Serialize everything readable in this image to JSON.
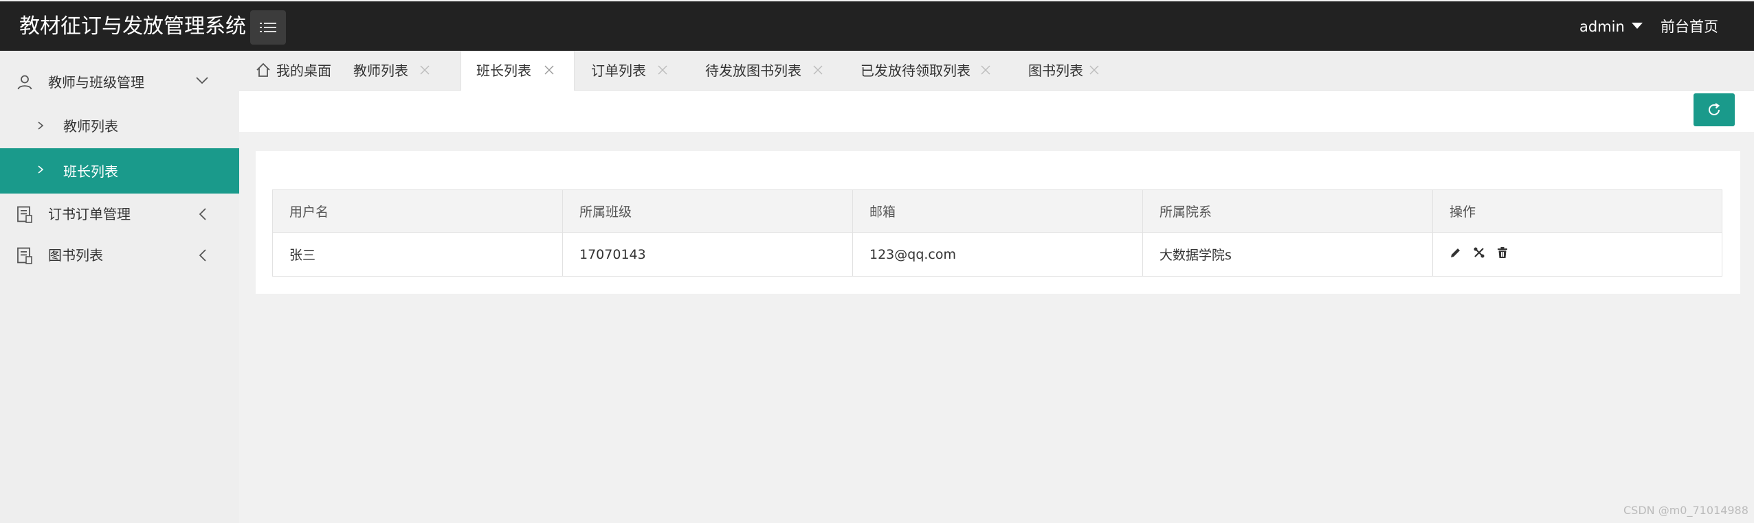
{
  "header": {
    "title": "教材征订与发放管理系统",
    "user": "admin",
    "front_link": "前台首页"
  },
  "sidebar": {
    "groups": [
      {
        "label": "教师与班级管理",
        "icon": "user-icon",
        "expanded": true,
        "children": [
          {
            "label": "教师列表"
          },
          {
            "label": "班长列表",
            "active": true
          }
        ]
      },
      {
        "label": "订书订单管理",
        "icon": "book-icon",
        "expanded": false
      },
      {
        "label": "图书列表",
        "icon": "book-icon",
        "expanded": false
      }
    ]
  },
  "tabs": [
    {
      "label": "我的桌面",
      "icon": "home-icon",
      "closable": false
    },
    {
      "label": "教师列表",
      "closable": true
    },
    {
      "label": "班长列表",
      "closable": true,
      "active": true
    },
    {
      "label": "订单列表",
      "closable": true
    },
    {
      "label": "待发放图书列表",
      "closable": true
    },
    {
      "label": "已发放待领取列表",
      "closable": true
    },
    {
      "label": "图书列表",
      "closable": true
    }
  ],
  "table": {
    "columns": [
      "用户名",
      "所属班级",
      "邮箱",
      "所属院系",
      "操作"
    ],
    "rows": [
      {
        "username": "张三",
        "class": "17070143",
        "email": "123@qq.com",
        "department": "大数据学院s",
        "actions": [
          "edit-icon",
          "reset-password-icon",
          "delete-icon"
        ]
      }
    ]
  },
  "watermark": "CSDN @m0_71014988",
  "colors": {
    "accent": "#1a9a8b",
    "header_bg": "#222222",
    "sidebar_bg": "#eeeeee"
  }
}
